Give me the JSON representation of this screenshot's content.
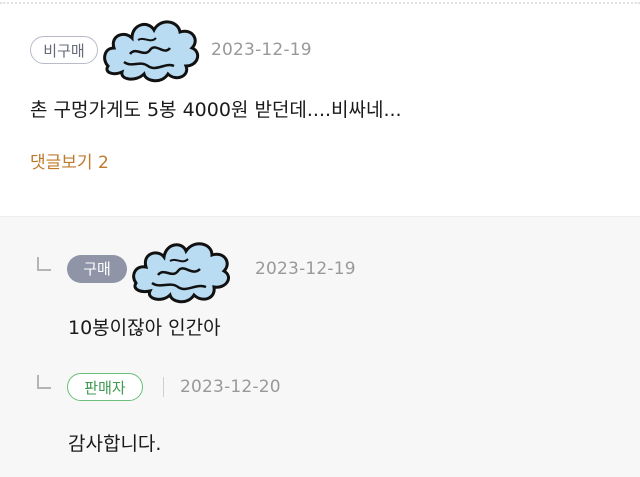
{
  "review": {
    "badge": "비구매",
    "date": "2023-12-19",
    "text": "촌 구멍가게도 5봉 4000원 받던데....비싸네...",
    "show_replies": "댓글보기 2"
  },
  "replies": [
    {
      "badge": "구매",
      "date": "2023-12-19",
      "text": "10봉이잖아 인간아"
    },
    {
      "badge": "판매자",
      "date": "2023-12-20",
      "text": "감사합니다."
    }
  ],
  "colors": {
    "more_link": "#c07a2c",
    "seller_badge": "#6cbf7a",
    "buyer_badge": "#8f95a6",
    "censor_cloud": "#b9dcf3"
  },
  "icons": {
    "reply": "reply-arrow-icon",
    "censor": "censor-cloud-icon"
  }
}
